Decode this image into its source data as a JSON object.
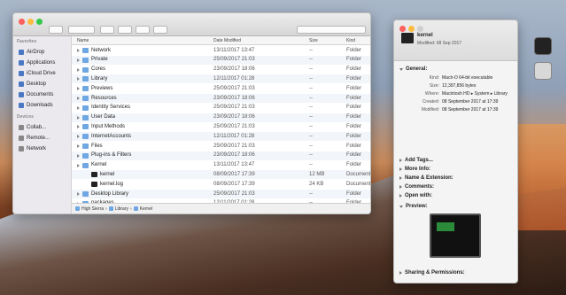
{
  "window": {
    "toolbar_labels": [
      "Back/Forward",
      "View",
      "Arrange",
      "Action",
      "Share",
      "Tags",
      "Search"
    ]
  },
  "sidebar": {
    "favorites_label": "Favorites",
    "items": [
      {
        "label": "AirDrop"
      },
      {
        "label": "Applications"
      },
      {
        "label": "iCloud Drive"
      },
      {
        "label": "Desktop"
      },
      {
        "label": "Documents"
      },
      {
        "label": "Downloads"
      }
    ],
    "devices_label": "Devices",
    "devices": [
      {
        "label": "Collab..."
      },
      {
        "label": "Remote..."
      },
      {
        "label": "Network"
      }
    ]
  },
  "columns": {
    "name": "Name",
    "date": "Date Modified",
    "size": "Size",
    "kind": "Kind"
  },
  "rows": [
    {
      "name": "Network",
      "date": "13/11/2017 13:47",
      "size": "--",
      "kind": "Folder",
      "dark": false,
      "indent": 0
    },
    {
      "name": "Private",
      "date": "25/09/2017 21:03",
      "size": "--",
      "kind": "Folder",
      "dark": false,
      "indent": 0
    },
    {
      "name": "Cores",
      "date": "23/09/2017 18:06",
      "size": "--",
      "kind": "Folder",
      "dark": false,
      "indent": 0
    },
    {
      "name": "Library",
      "date": "12/11/2017 01:28",
      "size": "--",
      "kind": "Folder",
      "dark": false,
      "indent": 0
    },
    {
      "name": "Previews",
      "date": "25/09/2017 21:03",
      "size": "--",
      "kind": "Folder",
      "dark": false,
      "indent": 0
    },
    {
      "name": "Resources",
      "date": "23/09/2017 18:06",
      "size": "--",
      "kind": "Folder",
      "dark": false,
      "indent": 0
    },
    {
      "name": "Identity Services",
      "date": "25/09/2017 21:03",
      "size": "--",
      "kind": "Folder",
      "dark": false,
      "indent": 0
    },
    {
      "name": "User Data",
      "date": "23/09/2017 18:06",
      "size": "--",
      "kind": "Folder",
      "dark": false,
      "indent": 0
    },
    {
      "name": "Input Methods",
      "date": "25/09/2017 21:03",
      "size": "--",
      "kind": "Folder",
      "dark": false,
      "indent": 0
    },
    {
      "name": "InternetAccounts",
      "date": "12/11/2017 01:28",
      "size": "--",
      "kind": "Folder",
      "dark": false,
      "indent": 0
    },
    {
      "name": "Files",
      "date": "25/09/2017 21:03",
      "size": "--",
      "kind": "Folder",
      "dark": false,
      "indent": 0
    },
    {
      "name": "Plug-ins & Filters",
      "date": "23/09/2017 18:06",
      "size": "--",
      "kind": "Folder",
      "dark": false,
      "indent": 0
    },
    {
      "name": "Kernel",
      "date": "13/11/2017 13:47",
      "size": "--",
      "kind": "Folder",
      "dark": false,
      "indent": 0
    },
    {
      "name": "kernel",
      "date": "08/09/2017 17:39",
      "size": "12 MB",
      "kind": "Document",
      "dark": true,
      "indent": 1
    },
    {
      "name": "kernel.log",
      "date": "08/09/2017 17:39",
      "size": "24 KB",
      "kind": "Document",
      "dark": true,
      "indent": 1
    },
    {
      "name": "Desktop Library",
      "date": "25/09/2017 21:03",
      "size": "--",
      "kind": "Folder",
      "dark": false,
      "indent": 0
    },
    {
      "name": "packages",
      "date": "12/11/2017 01:28",
      "size": "--",
      "kind": "Folder",
      "dark": false,
      "indent": 0
    }
  ],
  "pathbar": [
    "High Sierra",
    "Library",
    "Kernel"
  ],
  "info": {
    "name": "kernel",
    "subtitle": "Modified: 08 Sep 2017",
    "general_label": "General:",
    "general": [
      {
        "k": "Kind:",
        "v": "Mach-O 64-bit executable"
      },
      {
        "k": "Size:",
        "v": "12,397,856 bytes"
      },
      {
        "k": "Where:",
        "v": "Macintosh HD ▸ System ▸ Library"
      },
      {
        "k": "Created:",
        "v": "08 September 2017 at 17:39"
      },
      {
        "k": "Modified:",
        "v": "08 September 2017 at 17:39"
      }
    ],
    "sections": [
      {
        "label": "Add Tags...",
        "open": false
      },
      {
        "label": "More Info:",
        "open": false
      },
      {
        "label": "Name & Extension:",
        "open": false
      },
      {
        "label": "Comments:",
        "open": false
      },
      {
        "label": "Open with:",
        "open": false
      },
      {
        "label": "Preview:",
        "open": true
      }
    ],
    "sharing_label": "Sharing & Permissions:"
  },
  "colors": {
    "accent": "#4a78c2",
    "folder": "#6fa7e3"
  }
}
